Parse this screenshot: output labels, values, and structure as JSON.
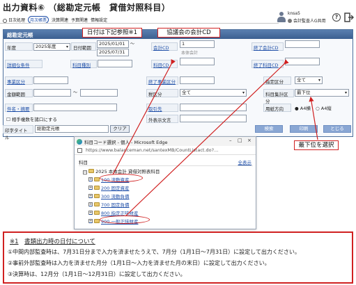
{
  "page": {
    "title": "出力資料⑥ （総勘定元帳　貸借対照科目）"
  },
  "menu": {
    "items": [
      {
        "label": "日次処理",
        "active": false
      },
      {
        "label": "月次帳票",
        "active": true
      },
      {
        "label": "決算関連",
        "active": false
      },
      {
        "label": "予算関連",
        "active": false
      },
      {
        "label": "情報設定",
        "active": false
      }
    ]
  },
  "user": {
    "name": "knsa5",
    "company": "会計監査人G共用"
  },
  "form": {
    "header": "総勘定元帳",
    "fiscal_year_label": "年度",
    "fiscal_year_value": "2025年度",
    "date_range_label": "日付範囲",
    "date_from": "2025/01/01",
    "date_to": "2025/07/31",
    "tilde": "～",
    "accounting_cd_label": "会計CD",
    "accounting_cd_value": "1",
    "accounting_name_hint": "本体会計",
    "end_accounting_cd_label": "終了会計CD",
    "detail_conditions_label": "詳細な条件",
    "account_type_label": "科目種別",
    "account_cd_label": "科目CD",
    "end_account_cd_label": "終了科目CD",
    "business_div_label": "事業区分",
    "end_business_div_label": "終了事業区分",
    "designated_div_label": "指定区分",
    "designated_div_value": "全て",
    "amount_range_label": "金額範囲",
    "tax_div_label": "税区分",
    "tax_div_value": "全て",
    "account_total_div_label": "科目集計区分",
    "account_total_div_value": "最下位",
    "item_summary_label": "件名・摘要",
    "partner_label": "取引先",
    "paper_orientation_label": "用紙方向",
    "paper_landscape": "A4横",
    "paper_portrait": "A4縦",
    "counter_account_label": "相手複数を諸口にする",
    "out_of_scope_label": "外表示文言",
    "print_title_label": "印字タイトル",
    "print_title_value": "総勘定元帳",
    "clear_button": "クリア",
    "preview_button": "検索",
    "print_button": "印刷",
    "close_button": "とじる"
  },
  "callouts": {
    "date_note": "日付は下記参照※1",
    "association_cd": "協議会の会計CD",
    "lowest_level": "最下位を選択"
  },
  "popup": {
    "window_title": "科目コード選択 - 個人 - Microsoft Edge",
    "url": "https://www.balanceman.net/santexMB/CountListact.do?...",
    "header_label": "科目",
    "select_all": "全表示",
    "root_label": "2025 本体会計 貸借対照表科目",
    "items": [
      {
        "code_label": "100 流動資産",
        "highlighted": true
      },
      {
        "code_label": "200 固定資産",
        "highlighted": false
      },
      {
        "code_label": "300 流動負債",
        "highlighted": false
      },
      {
        "code_label": "700 固定負債",
        "highlighted": false
      },
      {
        "code_label": "800 指定正味財産",
        "highlighted": false
      },
      {
        "code_label": "900 一般正味財産",
        "highlighted": true
      }
    ]
  },
  "note": {
    "title_prefix": "※1",
    "title": "書類出力時の日付について",
    "lines": [
      "①中間内部監査時は、7月31日分まで入力を済ませたうえで、7月分（1月1日～7月31日）に設定して出力ください。",
      "②事前外部監査時は入力を済ませた月分（1月1日～入力を済ませた月の末日）に設定して出力ください。",
      "③決算時は、12月分（1月1日～12月31日）に設定して出力ください。"
    ]
  },
  "colors": {
    "accent_blue": "#1f4fa8",
    "header_blue": "#3b5f90",
    "callout_red": "#d02020"
  }
}
